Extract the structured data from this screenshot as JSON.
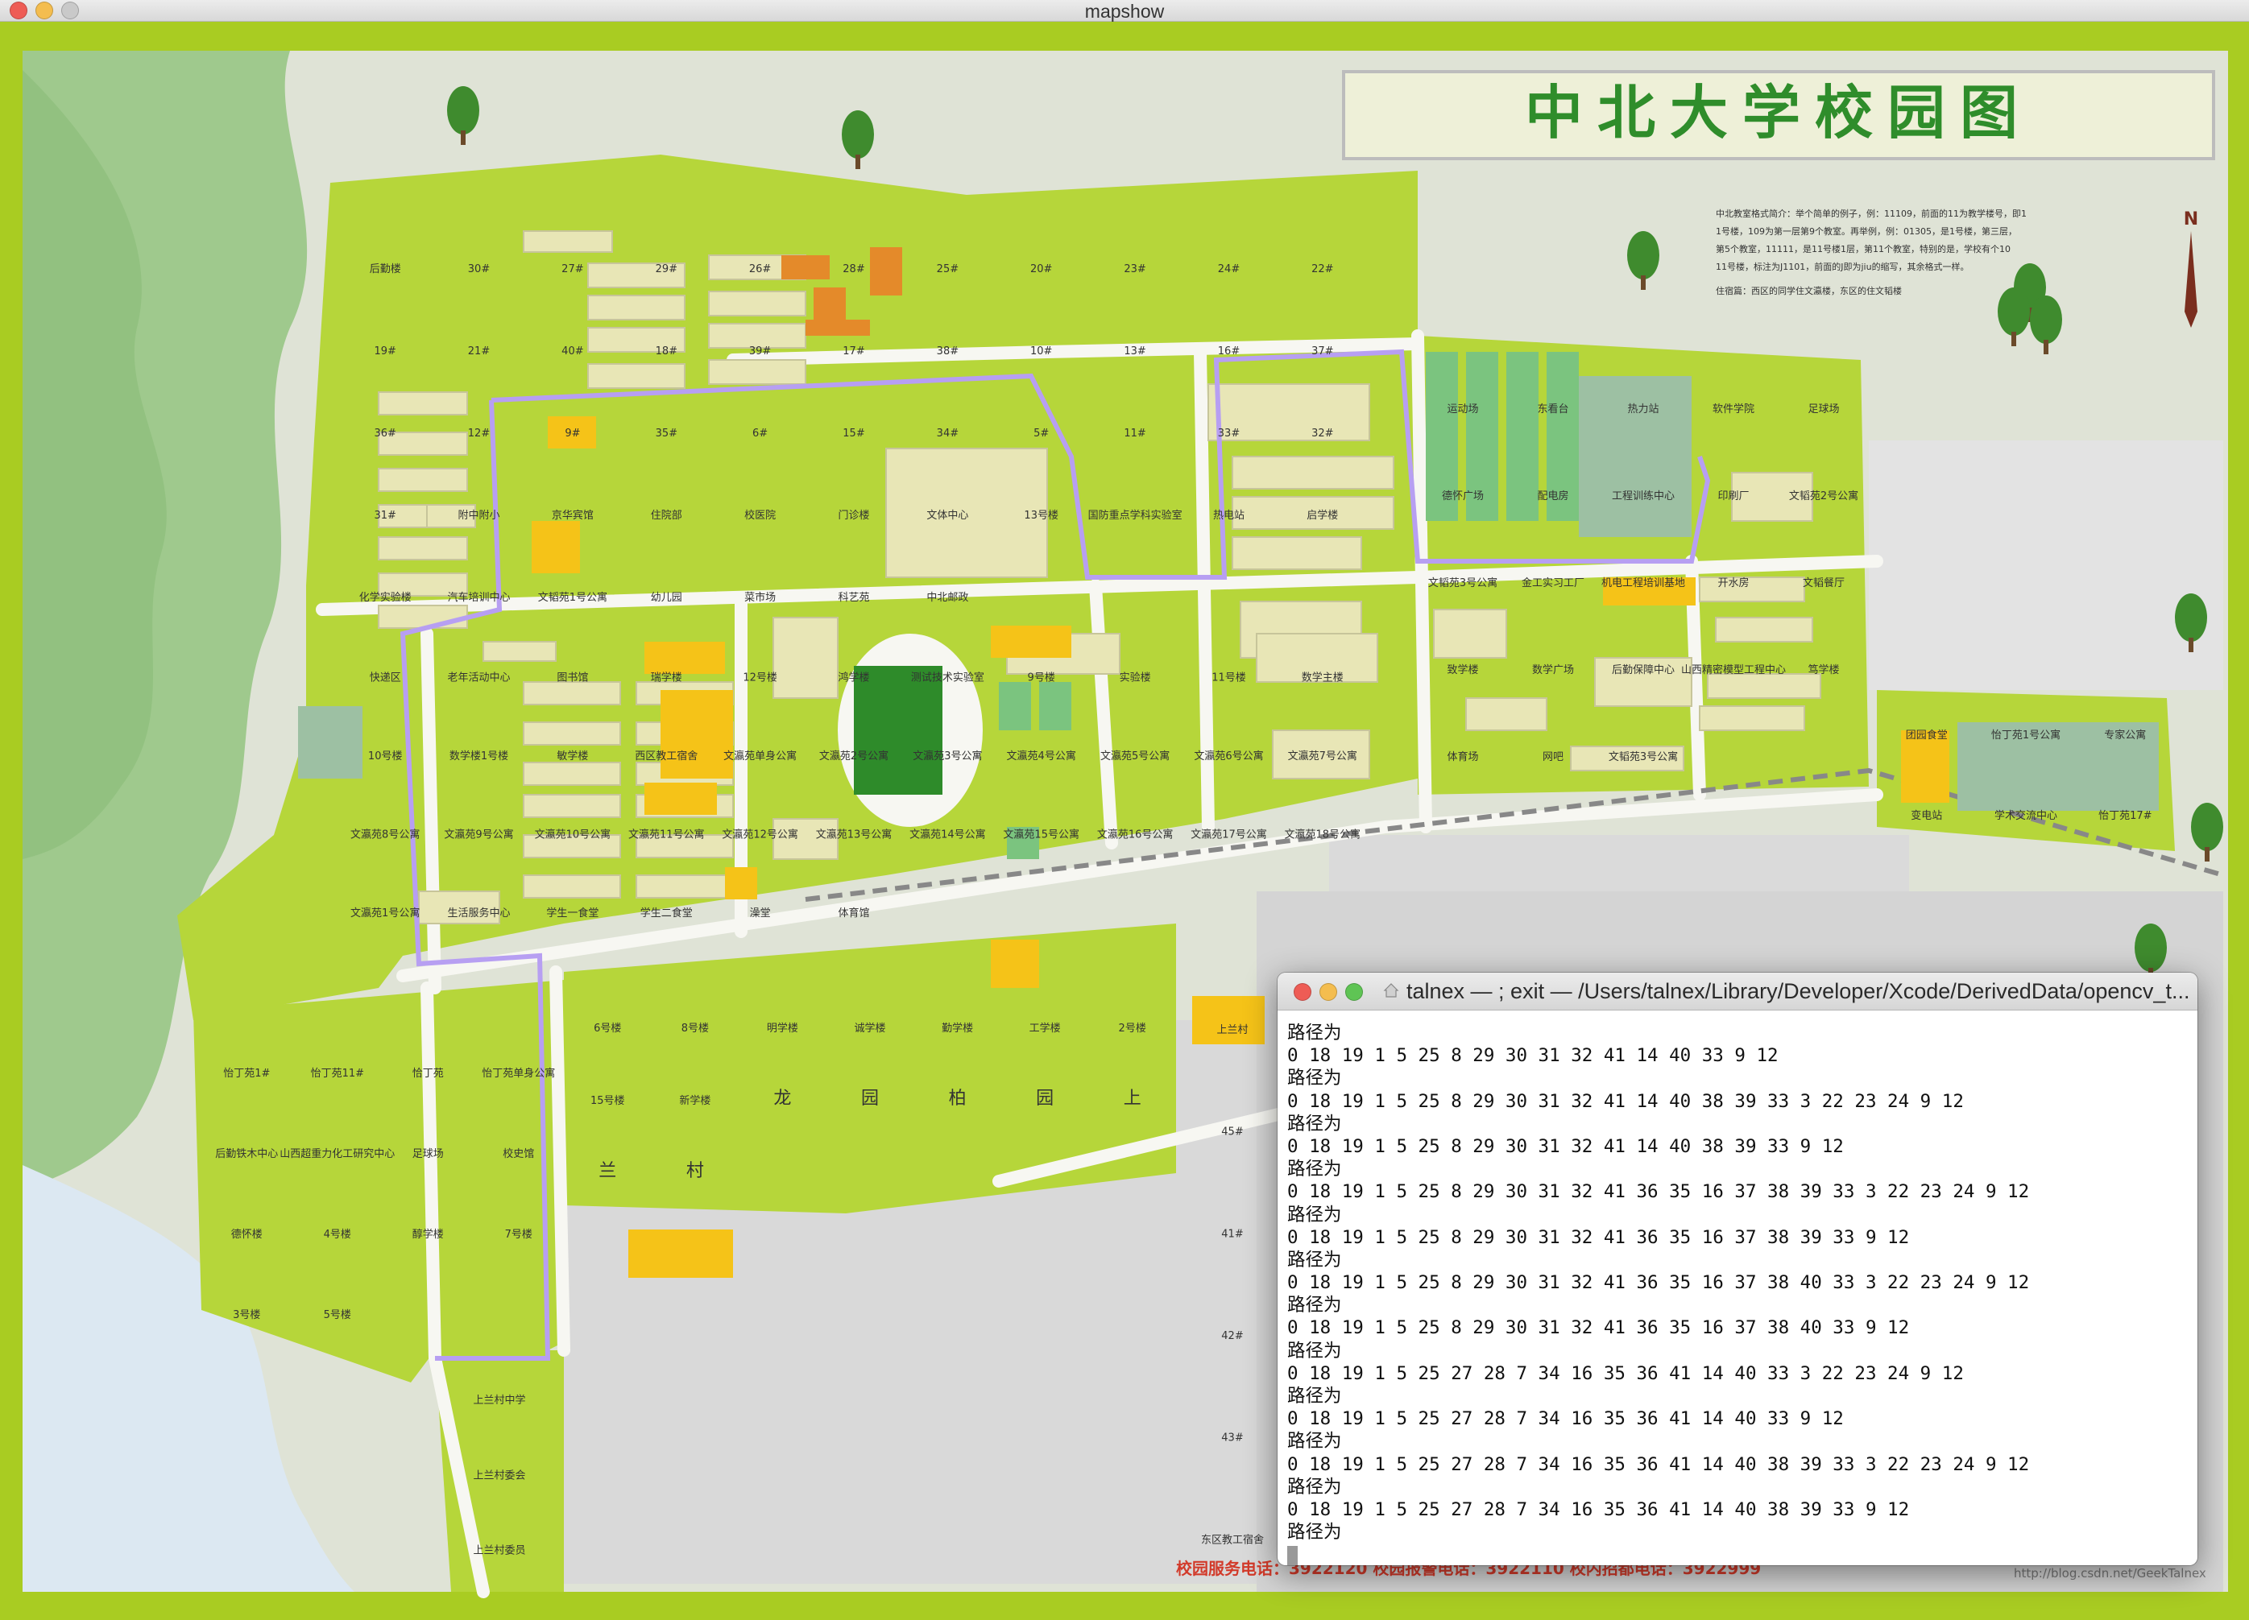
{
  "window": {
    "title": "mapshow"
  },
  "map": {
    "heading": "中北大学校园图",
    "north_marker": "N",
    "school_notes": [
      "中北教室格式简介：举个简单的例子，例：11109，前面的11为教学楼号，即11号楼，109为第一层第9个教室。再举例，例：01305，是1号楼，第三层，第5个教室，11111，是11号楼1层，第11个教室，特别的是，学校有个1011号楼，标注为J1101，前面的J即为jiu的缩写，其余格式一样。",
      "住宿篇：西区的同学住文瀛楼，东区的住文韬楼"
    ],
    "footer": "校园服务电话：3922120  校园报警电话：3922110  校内招都电话：3922999",
    "watermark": "http://blog.csdn.net/GeekTalnex",
    "labels": [
      "后勤楼",
      "30#",
      "27#",
      "29#",
      "26#",
      "28#",
      "25#",
      "20#",
      "23#",
      "24#",
      "22#",
      "19#",
      "21#",
      "40#",
      "18#",
      "39#",
      "17#",
      "38#",
      "10#",
      "13#",
      "16#",
      "37#",
      "36#",
      "12#",
      "9#",
      "35#",
      "6#",
      "15#",
      "34#",
      "5#",
      "11#",
      "33#",
      "32#",
      "31#",
      "附中附小",
      "京华宾馆",
      "住院部",
      "校医院",
      "门诊楼",
      "文体中心",
      "13号楼",
      "国防重点学科实验室",
      "热电站",
      "启学楼",
      "化学实验楼",
      "汽车培训中心",
      "文韬苑1号公寓",
      "幼儿园",
      "菜市场",
      "科艺苑",
      "中北邮政",
      "快递区",
      "老年活动中心",
      "图书馆",
      "瑞学楼",
      "12号楼",
      "鸿学楼",
      "测试技术实验室",
      "9号楼",
      "实验楼",
      "11号楼",
      "数学主楼",
      "10号楼",
      "数学楼1号楼",
      "敏学楼",
      "西区教工宿舍",
      "文瀛苑单身公寓",
      "文瀛苑2号公寓",
      "文瀛苑3号公寓",
      "文瀛苑4号公寓",
      "文瀛苑5号公寓",
      "文瀛苑6号公寓",
      "文瀛苑7号公寓",
      "文瀛苑8号公寓",
      "文瀛苑9号公寓",
      "文瀛苑10号公寓",
      "文瀛苑11号公寓",
      "文瀛苑12号公寓",
      "文瀛苑13号公寓",
      "文瀛苑14号公寓",
      "文瀛苑15号公寓",
      "文瀛苑16号公寓",
      "文瀛苑17号公寓",
      "文瀛苑18号公寓",
      "文瀛苑1号公寓",
      "生活服务中心",
      "学生一食堂",
      "学生二食堂",
      "澡堂",
      "体育馆",
      "运动场",
      "东看台",
      "热力站",
      "软件学院",
      "足球场",
      "德怀广场",
      "配电房",
      "工程训练中心",
      "印刷厂",
      "文韬苑2号公寓",
      "文韬苑3号公寓",
      "金工实习工厂",
      "机电工程培训基地",
      "开水房",
      "文韬餐厅",
      "致学楼",
      "数学广场",
      "后勤保障中心",
      "山西精密模型工程中心",
      "笃学楼",
      "体育场",
      "网吧",
      "文韬苑3号公寓",
      "团园食堂",
      "怡丁苑1号公寓",
      "专家公寓",
      "变电站",
      "学术交流中心",
      "怡丁苑17#",
      "怡丁苑1#",
      "怡丁苑11#",
      "恰丁苑",
      "怡丁苑单身公寓",
      "后勤铁木中心",
      "山西超重力化工研究中心",
      "足球场",
      "校史馆",
      "德怀楼",
      "4号楼",
      "醇学楼",
      "7号楼",
      "3号楼",
      "5号楼",
      "6号楼",
      "8号楼",
      "明学楼",
      "诚学楼",
      "勤学楼",
      "工学楼",
      "2号楼",
      "15号楼",
      "新学楼",
      "龙",
      "园",
      "柏",
      "园",
      "上",
      "兰",
      "村",
      "上兰村中学",
      "上兰村委会",
      "上兰村委员",
      "上兰村",
      "45#",
      "41#",
      "42#",
      "43#",
      "东区教工宿舍"
    ],
    "colors": {
      "frame": "#aacd1f",
      "grass": "#b6d63a",
      "road": "#f6f7f3",
      "building": "#e8e6b6",
      "route": "#b79ff2",
      "water": "#dde9f4",
      "mountain": "#a8cf97"
    }
  },
  "terminal": {
    "title": "talnex — ; exit — /Users/talnex/Library/Developer/Xcode/DerivedData/opencv_t...",
    "lines": [
      "路径为",
      "0 18 19 1 5 25 8 29 30 31 32 41 14 40 33 9 12",
      "路径为",
      "0 18 19 1 5 25 8 29 30 31 32 41 14 40 38 39 33 3 22 23 24 9 12",
      "路径为",
      "0 18 19 1 5 25 8 29 30 31 32 41 14 40 38 39 33 9 12",
      "路径为",
      "0 18 19 1 5 25 8 29 30 31 32 41 36 35 16 37 38 39 33 3 22 23 24 9 12",
      "路径为",
      "0 18 19 1 5 25 8 29 30 31 32 41 36 35 16 37 38 39 33 9 12",
      "路径为",
      "0 18 19 1 5 25 8 29 30 31 32 41 36 35 16 37 38 40 33 3 22 23 24 9 12",
      "路径为",
      "0 18 19 1 5 25 8 29 30 31 32 41 36 35 16 37 38 40 33 9 12",
      "路径为",
      "0 18 19 1 5 25 27 28 7 34 16 35 36 41 14 40 33 3 22 23 24 9 12",
      "路径为",
      "0 18 19 1 5 25 27 28 7 34 16 35 36 41 14 40 33 9 12",
      "路径为",
      "0 18 19 1 5 25 27 28 7 34 16 35 36 41 14 40 38 39 33 3 22 23 24 9 12",
      "路径为",
      "0 18 19 1 5 25 27 28 7 34 16 35 36 41 14 40 38 39 33 9 12",
      "路径为"
    ]
  }
}
